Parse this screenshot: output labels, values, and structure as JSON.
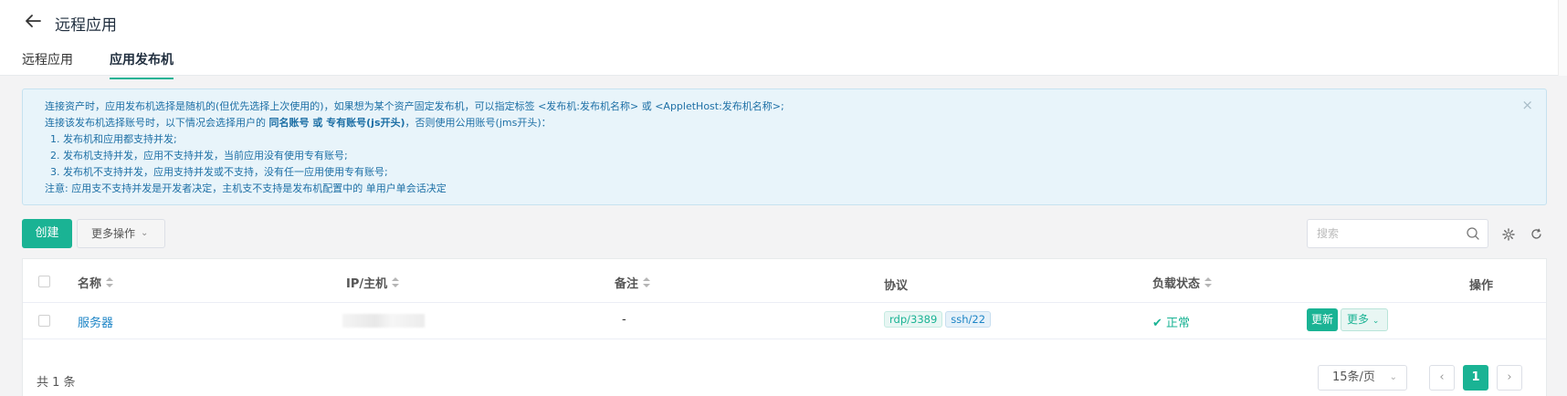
{
  "header": {
    "title": "远程应用",
    "tabs": [
      {
        "label": "远程应用",
        "active": false
      },
      {
        "label": "应用发布机",
        "active": true
      }
    ]
  },
  "alert": {
    "line1": "连接资产时，应用发布机选择是随机的(但优先选择上次使用的)，如果想为某个资产固定发布机，可以指定标签 <发布机:发布机名称> 或 <AppletHost:发布机名称>;",
    "line2_pre": "连接该发布机选择账号时，以下情况会选择用户的 ",
    "line2_bold": "同名账号 或 专有账号(js开头)",
    "line2_post": "，否则使用公用账号(jms开头)：",
    "item1": "1. 发布机和应用都支持并发;",
    "item2": "2. 发布机支持并发，应用不支持并发，当前应用没有使用专有账号;",
    "item3": "3. 发布机不支持并发，应用支持并发或不支持，没有任一应用使用专有账号;",
    "note": "注意: 应用支不支持并发是开发者决定，主机支不支持是发布机配置中的 单用户单会话决定",
    "close": "×"
  },
  "toolbar": {
    "create_label": "创建",
    "more_actions_label": "更多操作",
    "search_placeholder": "搜索"
  },
  "table": {
    "columns": {
      "name": "名称",
      "ip": "IP/主机",
      "comment": "备注",
      "protocols": "协议",
      "load": "负载状态",
      "actions": "操作"
    },
    "rows": [
      {
        "name": "服务器",
        "comment": "-",
        "protocol1": "rdp/3389",
        "protocol2": "ssh/22",
        "load": "正常",
        "update_label": "更新",
        "more_label": "更多"
      }
    ]
  },
  "pagination": {
    "total": "共 1 条",
    "page_size": "15条/页",
    "current_page": "1"
  },
  "colors": {
    "primary": "#1ab394",
    "link": "#1c84c6",
    "alert_bg": "#e8f4fa"
  }
}
